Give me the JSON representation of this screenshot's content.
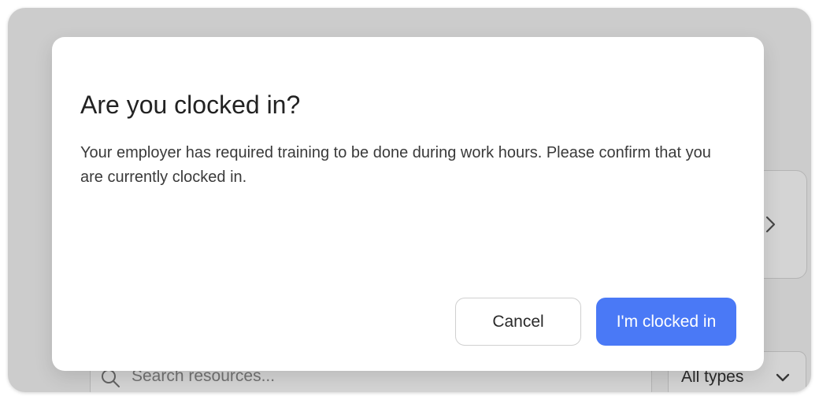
{
  "background": {
    "search": {
      "placeholder": "Search resources..."
    },
    "type_filter": {
      "selected": "All types"
    }
  },
  "modal": {
    "title": "Are you clocked in?",
    "body": "Your employer has required training to be done during work hours. Please confirm that you are currently clocked in.",
    "cancel_label": "Cancel",
    "confirm_label": "I'm clocked in"
  },
  "colors": {
    "primary": "#4a79f6",
    "overlay": "rgba(0,0,0,0.17)"
  },
  "icons": {
    "card_chevron": "chevron-right-icon",
    "search": "search-icon",
    "select_chevron": "chevron-down-icon"
  }
}
